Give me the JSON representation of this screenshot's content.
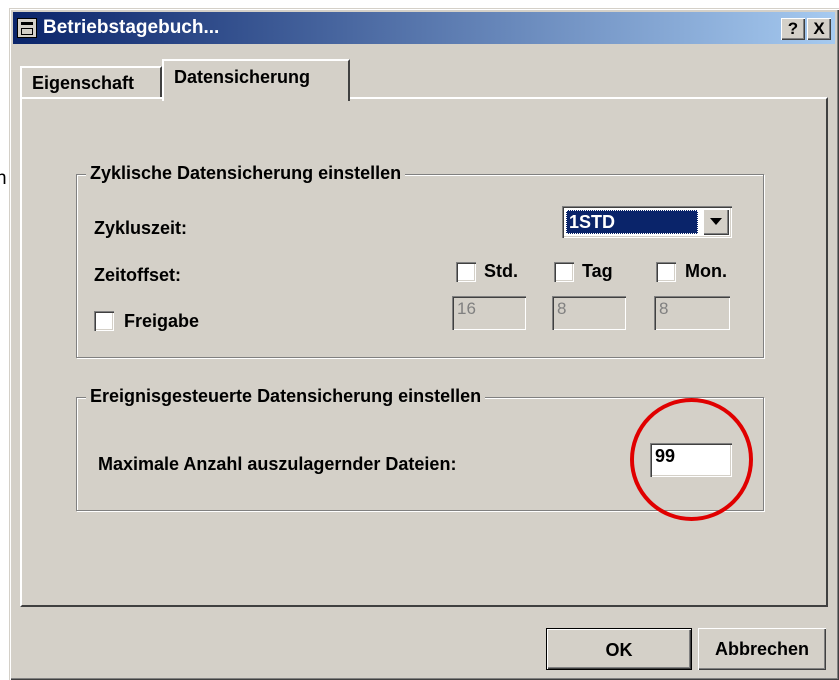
{
  "background_text": "n",
  "window": {
    "title": "Betriebstagebuch...",
    "help_button": "?",
    "close_button": "X"
  },
  "tabs": [
    {
      "label": "Eigenschaft",
      "active": false
    },
    {
      "label": "Datensicherung",
      "active": true
    }
  ],
  "cyclic_group": {
    "title": "Zyklische Datensicherung einstellen",
    "cycle_time_label": "Zykluszeit:",
    "cycle_time_value": "1STD",
    "time_offset_label": "Zeitoffset:",
    "release_label": "Freigabe",
    "offsets": [
      {
        "label": "Std.",
        "value": "16",
        "checked": false
      },
      {
        "label": "Tag",
        "value": "8",
        "checked": false
      },
      {
        "label": "Mon.",
        "value": "8",
        "checked": false
      }
    ],
    "release_checked": false
  },
  "event_group": {
    "title": "Ereignisgesteuerte Datensicherung einstellen",
    "max_files_label": "Maximale Anzahl auszulagernder Dateien:",
    "max_files_value": "99"
  },
  "buttons": {
    "ok": "OK",
    "cancel": "Abbrechen"
  },
  "colors": {
    "titlebar": "#0a246a",
    "dialog_bg": "#d4d0c8",
    "annotation": "#e00000"
  }
}
